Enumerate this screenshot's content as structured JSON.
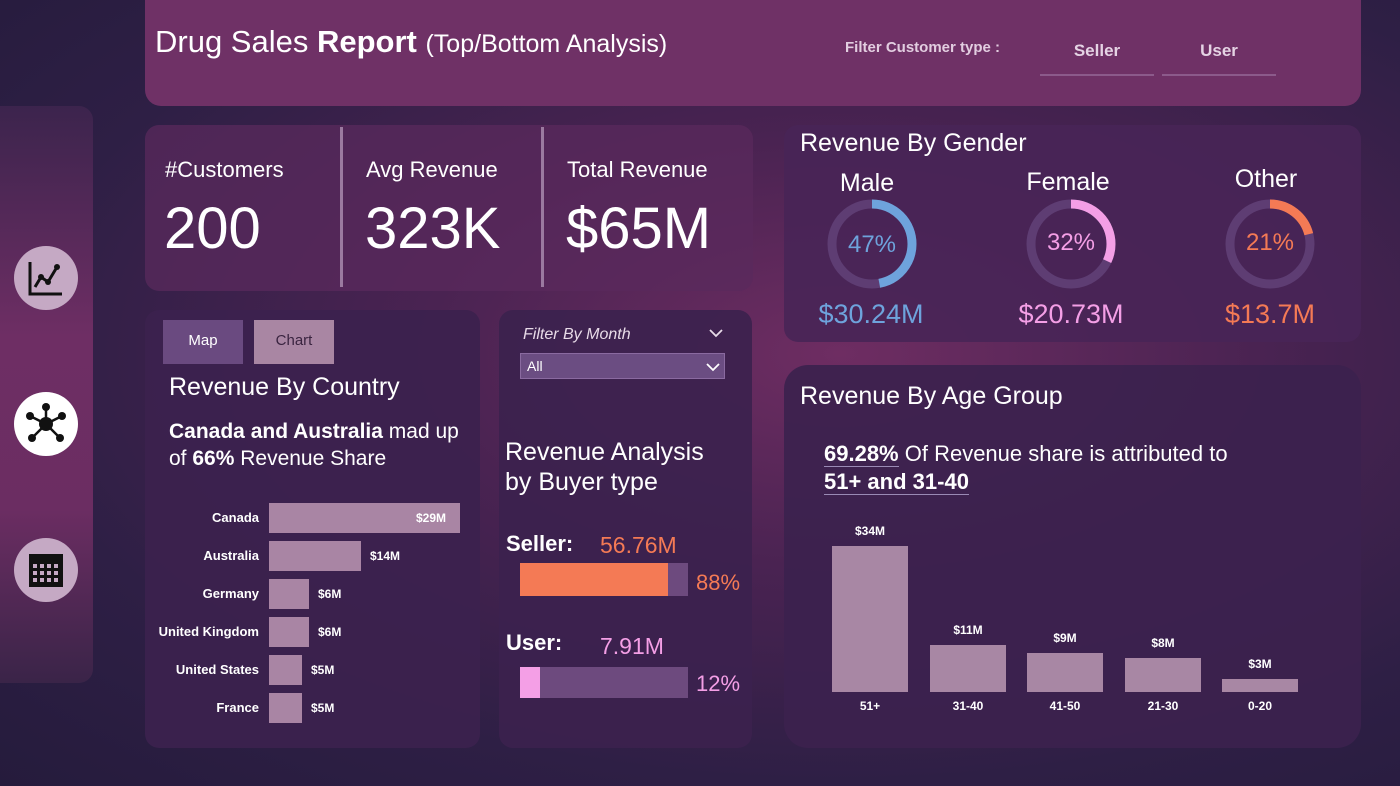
{
  "header": {
    "title_main": "Drug Sales ",
    "title_bold": "Report",
    "title_sub": "(Top/Bottom Analysis)",
    "filter_label": "Filter Customer type :",
    "filters": [
      "Seller",
      "User"
    ]
  },
  "sidebar": {
    "items": [
      {
        "icon": "line-chart-icon"
      },
      {
        "icon": "network-icon"
      },
      {
        "icon": "calendar-icon"
      }
    ]
  },
  "kpis": [
    {
      "label": "#Customers",
      "value": "200"
    },
    {
      "label": "Avg Revenue",
      "value": "323K"
    },
    {
      "label": "Total Revenue",
      "value": "$65M"
    }
  ],
  "gender": {
    "title": "Revenue By Gender",
    "items": [
      {
        "label": "Male",
        "pct_text": "47%",
        "pct": 0.47,
        "value": "$30.24M",
        "color": "#6ea3dc",
        "label_color": "#ffffff"
      },
      {
        "label": "Female",
        "pct_text": "32%",
        "pct": 0.32,
        "value": "$20.73M",
        "color": "#f49fe6",
        "label_color": "#ffffff"
      },
      {
        "label": "Other",
        "pct_text": "21%",
        "pct": 0.21,
        "value": "$13.7M",
        "color": "#f47a55",
        "label_color": "#ffffff"
      }
    ]
  },
  "country": {
    "tabs": [
      "Map",
      "Chart"
    ],
    "title": "Revenue By Country",
    "insight_bold": "Canada and Australia",
    "insight_mid": " mad up of ",
    "insight_pct": "66%",
    "insight_end": "  Revenue Share",
    "chart_data": {
      "type": "bar",
      "orientation": "horizontal",
      "categories": [
        "Canada",
        "Australia",
        "Germany",
        "United Kingdom",
        "United States",
        "France"
      ],
      "values": [
        29,
        14,
        6,
        6,
        5,
        5
      ],
      "labels": [
        "$29M",
        "$14M",
        "$6M",
        "$6M",
        "$5M",
        "$5M"
      ],
      "unit": "$M"
    }
  },
  "buyer": {
    "filter_label": "Filter By Month",
    "filter_value": "All",
    "title_line1": "Revenue Analysis",
    "title_line2": "by Buyer type",
    "items": [
      {
        "label": "Seller:",
        "value": "56.76M",
        "pct_text": "88%",
        "pct": 0.88,
        "color": "#f47a55"
      },
      {
        "label": "User:",
        "value": "7.91M",
        "pct_text": "12%",
        "pct": 0.12,
        "color": "#f49fe6"
      }
    ]
  },
  "age": {
    "title": "Revenue By Age Group",
    "insight_pct": "69.28%",
    "insight_mid": " Of Revenue share is attributed to",
    "insight_groups": "51+ and 31-40",
    "chart_data": {
      "type": "bar",
      "categories": [
        "51+",
        "31-40",
        "41-50",
        "21-30",
        "0-20"
      ],
      "values": [
        34,
        11,
        9,
        8,
        3
      ],
      "labels": [
        "$34M",
        "$11M",
        "$9M",
        "$8M",
        "$3M"
      ],
      "unit": "$M"
    }
  }
}
